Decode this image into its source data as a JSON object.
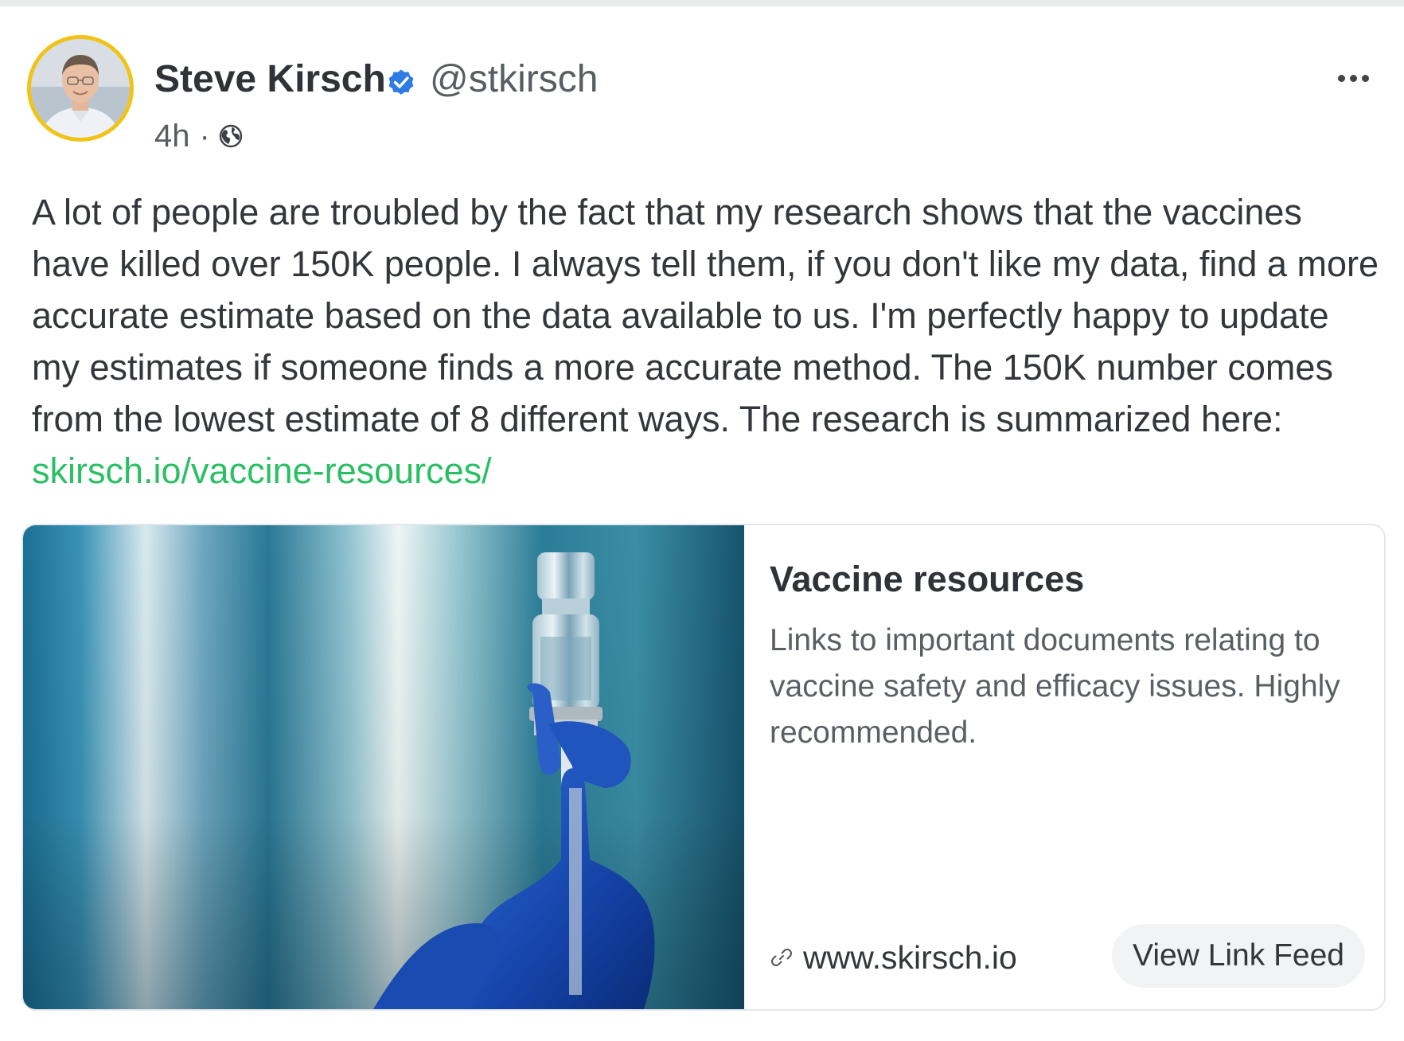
{
  "post": {
    "author": {
      "name": "Steve Kirsch",
      "handle": "@stkirsch",
      "verified": true
    },
    "time": "4h",
    "separator": "·",
    "visibility_icon": "globe-icon",
    "more_icon": "more-horizontal-icon",
    "text": "A lot of people are troubled by the fact that my research shows that the vaccines have killed over 150K people. I always tell them, if you don't like my data, find a more accurate estimate based on the data available to us. I'm perfectly happy to update my estimates if someone finds a more accurate method. The 150K number comes from the lowest estimate of 8 different ways. The research is summarized here: ",
    "link_text": "skirsch.io/vaccine-resources/"
  },
  "card": {
    "title": "Vaccine resources",
    "description": "Links to important documents relating to vaccine safety and efficacy issues. Highly recommended.",
    "domain": "www.skirsch.io",
    "button_label": "View Link Feed",
    "image_icon": "vaccine-vial-image"
  },
  "colors": {
    "link": "#2bbf63",
    "verified": "#2f7be5",
    "avatar_ring": "#f2c315",
    "text": "#33363a"
  }
}
